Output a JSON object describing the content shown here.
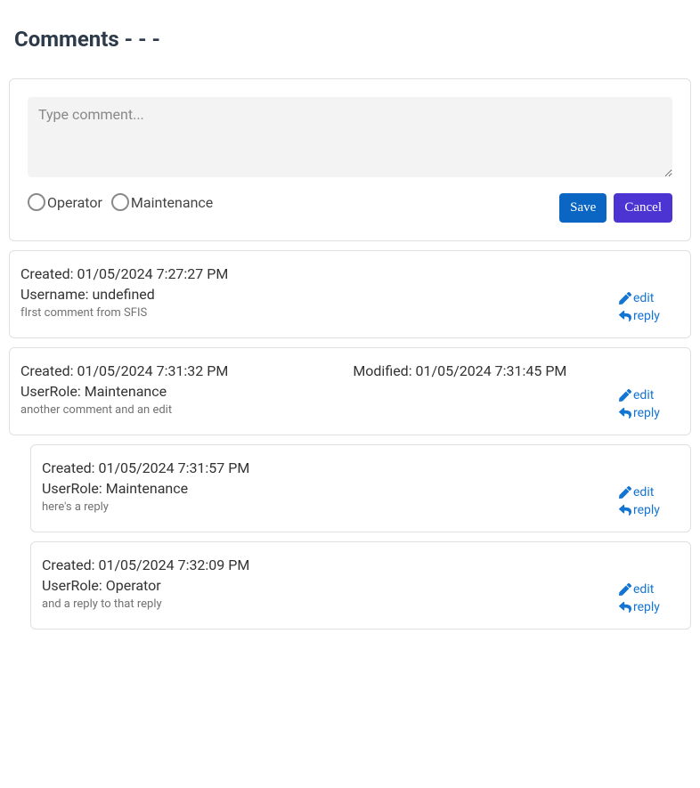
{
  "title": "Comments -  -  -",
  "compose": {
    "placeholder": "Type comment...",
    "value": "",
    "role_operator_label": "Operator",
    "role_maintenance_label": "Maintenance",
    "save_label": "Save",
    "cancel_label": "Cancel"
  },
  "action_labels": {
    "edit": "edit",
    "reply": "reply"
  },
  "comments": [
    {
      "created_label": "Created: 01/05/2024 7:27:27 PM",
      "modified_label": "",
      "user_line": "Username: undefined",
      "body": "fIrst comment from SFIS",
      "replies": []
    },
    {
      "created_label": "Created: 01/05/2024 7:31:32 PM",
      "modified_label": "Modified: 01/05/2024 7:31:45 PM",
      "user_line": "UserRole: Maintenance",
      "body": "another comment and an edit",
      "replies": [
        {
          "created_label": "Created: 01/05/2024 7:31:57 PM",
          "modified_label": "",
          "user_line": "UserRole: Maintenance",
          "body": "here's a reply"
        },
        {
          "created_label": "Created: 01/05/2024 7:32:09 PM",
          "modified_label": "",
          "user_line": "UserRole: Operator",
          "body": "and a reply to that reply"
        }
      ]
    }
  ]
}
